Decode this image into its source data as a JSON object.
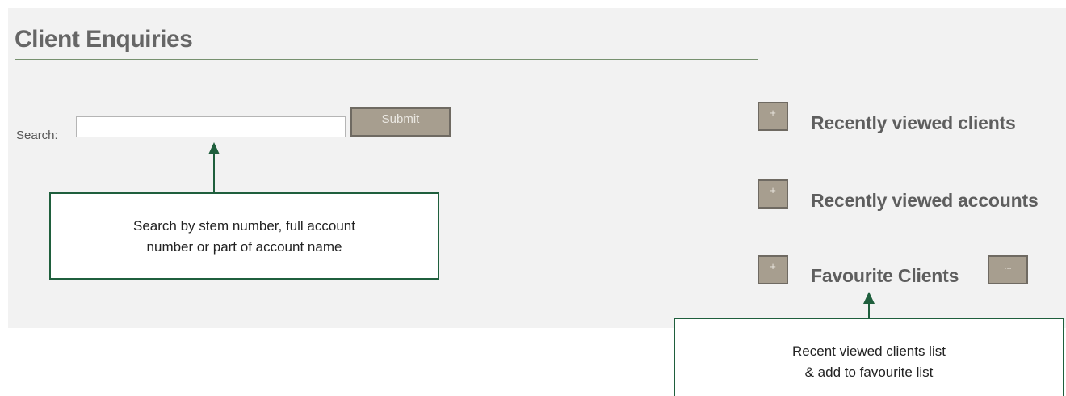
{
  "page": {
    "title": "Client Enquiries"
  },
  "search": {
    "label": "Search:",
    "value": "",
    "placeholder": "",
    "submit_label": "Submit"
  },
  "sections": {
    "expand_label": "+",
    "recent_clients_label": "Recently viewed clients",
    "recent_accounts_label": "Recently viewed accounts",
    "favourite_clients_label": "Favourite Clients",
    "favourite_more_label": "..."
  },
  "callouts": {
    "search": {
      "line1": "Search by stem number, full account",
      "line2": "number or part of account name"
    },
    "favourites": {
      "line1": "Recent viewed clients list",
      "line2": "& add to favourite list"
    }
  },
  "colors": {
    "button_fill": "#a79e8f",
    "callout_border": "#1f5f3d",
    "heading_text": "#666666"
  }
}
